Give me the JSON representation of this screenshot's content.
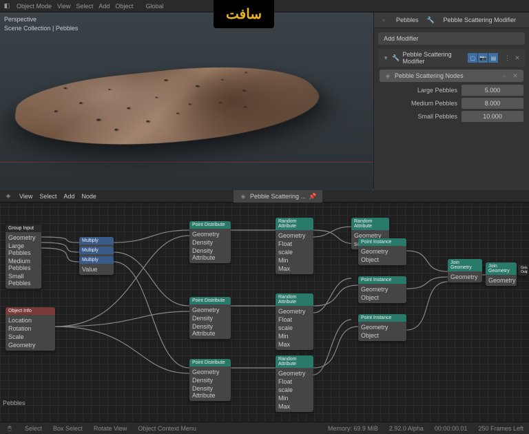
{
  "topbar": {
    "mode": "Object Mode",
    "menus": [
      "View",
      "Select",
      "Add",
      "Object"
    ],
    "orientation": "Global"
  },
  "logo": "سافت",
  "viewport": {
    "persp": "Perspective",
    "collection": "Scene Collection | Pebbles"
  },
  "sidepanel": {
    "tab1": "Pebbles",
    "tab2": "Pebble Scattering Modifier",
    "addmod": "Add Modifier",
    "modname": "Pebble Scattering Modifier",
    "nodeselect": "Pebble Scattering Nodes",
    "props": [
      {
        "label": "Large Pebbles",
        "value": "5.000"
      },
      {
        "label": "Medium Pebbles",
        "value": "8.000"
      },
      {
        "label": "Small Pebbles",
        "value": "10.000"
      }
    ]
  },
  "nodeeditor": {
    "menus": [
      "View",
      "Select",
      "Add",
      "Node"
    ],
    "crumb": "Pebble Scattering ...",
    "nodes": {
      "groupin": "Group Input",
      "groupin_items": [
        "Geometry",
        "Large Pebbles",
        "Medium Pebbles",
        "Small Pebbles"
      ],
      "multiply": "Multiply",
      "objinfo": "Object Info",
      "objinfo_items": [
        "Location",
        "Rotation",
        "Scale",
        "Geometry"
      ],
      "pointdist": "Point Distribute",
      "pd_items": [
        "Geometry",
        "Density",
        "Density Attribute"
      ],
      "randattr": "Random Attribute",
      "ra_items": [
        "Geometry",
        "Float",
        "scale",
        "Min",
        "Max"
      ],
      "pointinst": "Point Instance",
      "pi_items": [
        "Geometry",
        "Object"
      ],
      "joingeom": "Join Geometry",
      "jg_items": [
        "Geometry"
      ],
      "groupout": "Group Output"
    }
  },
  "statusbar": {
    "left": [
      "Select",
      "Box Select",
      "Rotate View",
      "Object Context Menu"
    ],
    "right": [
      "Memory: 69.9 MiB",
      "2.92.0 Alpha",
      "00:00:00.01",
      "250 Frames Left"
    ]
  },
  "label": "Pebbles"
}
